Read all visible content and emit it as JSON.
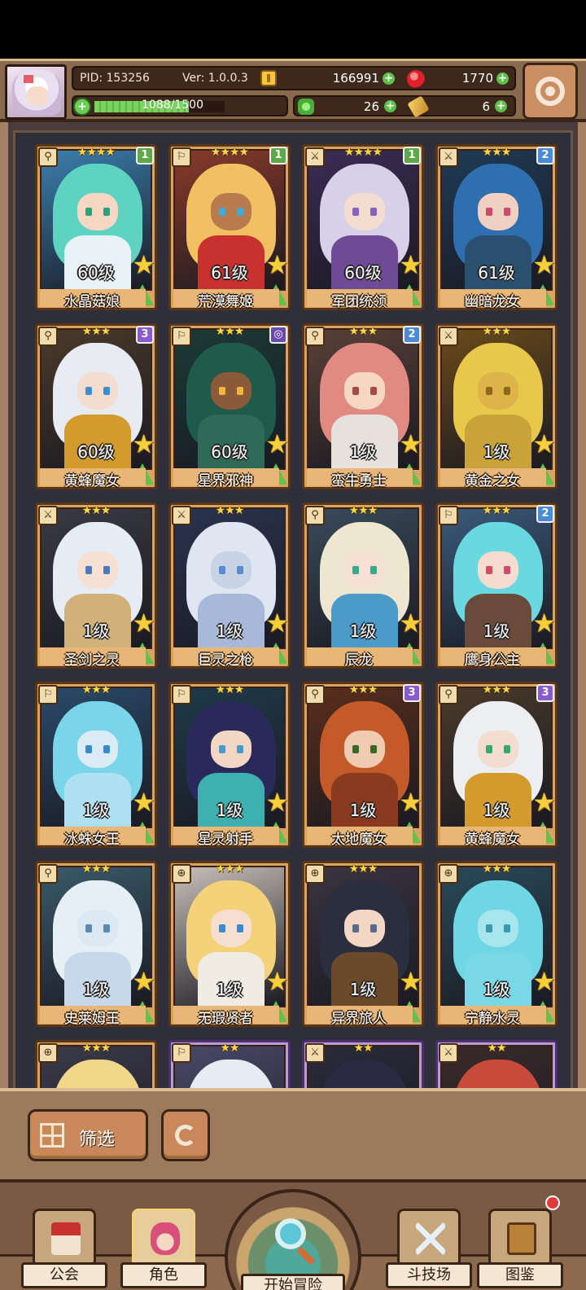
{
  "header": {
    "pid": "PID: 153256",
    "version": "Ver: 1.0.0.3",
    "gold": "166991",
    "gems": "1770",
    "exp": {
      "text": "1088/1500",
      "current": 1088,
      "max": 1500
    },
    "clover": "26",
    "scroll": "6",
    "plus_symbol": "+",
    "exp_symbol": "+",
    "icons": {
      "avatar": "player-avatar",
      "gold": "gold-coin-icon",
      "gem": "red-gem-icon",
      "clover": "clover-icon",
      "scroll": "scroll-icon",
      "settings": "gear-icon"
    }
  },
  "roster": [
    {
      "name": "水晶菇娘",
      "level": "60级",
      "rank": "1",
      "stars": "★★★★",
      "type": "⚲",
      "hair": "#5fd3c2",
      "skin": "#f6d7c4",
      "bg": "#3b7fae",
      "body": "#e9f2f7",
      "eye": "#2aa27a",
      "frame": "gold"
    },
    {
      "name": "荒漠舞姬",
      "level": "61级",
      "rank": "1",
      "stars": "★★★★",
      "type": "⚐",
      "hair": "#f2c062",
      "skin": "#b97a4e",
      "bg": "#8a3a2a",
      "body": "#c8322e",
      "eye": "#3fa9d8",
      "frame": "gold"
    },
    {
      "name": "军团统领",
      "level": "60级",
      "rank": "1",
      "stars": "★★★★",
      "type": "⚔",
      "hair": "#d8d0e8",
      "skin": "#f3dcd0",
      "bg": "#3b2c55",
      "body": "#6f4b96",
      "eye": "#8a5fc4",
      "frame": "gold"
    },
    {
      "name": "幽暗龙女",
      "level": "61级",
      "rank": "2",
      "stars": "★★★",
      "type": "⚔",
      "hair": "#2f6fb0",
      "skin": "#f0d0c2",
      "bg": "#1f3b55",
      "body": "#2b4f6e",
      "eye": "#c94a6a",
      "frame": "gold"
    },
    {
      "name": "黄蜂魔女",
      "level": "60级",
      "rank": "3",
      "stars": "★★★",
      "type": "⚲",
      "hair": "#e8ecf2",
      "skin": "#f3dcd0",
      "bg": "#4a3a2a",
      "body": "#d39a2e",
      "eye": "#3c8fd0",
      "frame": "gold"
    },
    {
      "name": "星界邪神",
      "level": "60级",
      "rank": "◎",
      "stars": "★★★",
      "type": "⚐",
      "hair": "#1f5a4a",
      "skin": "#8a5a3a",
      "bg": "#1c3a36",
      "body": "#2f6a58",
      "eye": "#f0b43a",
      "frame": "gold"
    },
    {
      "name": "蛮牛勇士",
      "level": "1级",
      "rank": "2",
      "stars": "★★★",
      "type": "⚲",
      "hair": "#e08a82",
      "skin": "#f6d7c4",
      "bg": "#5a4038",
      "body": "#e7e1dd",
      "eye": "#a44a4a",
      "frame": "gold"
    },
    {
      "name": "黄金之女",
      "level": "1级",
      "rank": "",
      "stars": "★★★",
      "type": "⚔",
      "hair": "#e8c84a",
      "skin": "#dcb44a",
      "bg": "#6a4a1a",
      "body": "#c9a23a",
      "eye": "#8a6a1a",
      "frame": "gold"
    },
    {
      "name": "圣剑之灵",
      "level": "1级",
      "rank": "",
      "stars": "★★★",
      "type": "⚔",
      "hair": "#e6ecf4",
      "skin": "#f6e0d4",
      "bg": "#3a3a44",
      "body": "#d2b07a",
      "eye": "#4a7ac0",
      "frame": "gold"
    },
    {
      "name": "巨灵之枪",
      "level": "1级",
      "rank": "",
      "stars": "★★★",
      "type": "⚔",
      "hair": "#dfe6f2",
      "skin": "#c8d4e6",
      "bg": "#2a3450",
      "body": "#a8b8d8",
      "eye": "#5a8ad0",
      "frame": "gold"
    },
    {
      "name": "辰龙",
      "level": "1级",
      "rank": "",
      "stars": "★★★",
      "type": "⚲",
      "hair": "#efe6d2",
      "skin": "#f6e0d4",
      "bg": "#3a4a5a",
      "body": "#4c9ac8",
      "eye": "#3aa88a",
      "frame": "gold"
    },
    {
      "name": "鹰身公主",
      "level": "1级",
      "rank": "2",
      "stars": "★★★",
      "type": "⚐",
      "hair": "#6ad8e0",
      "skin": "#f6dcd0",
      "bg": "#3a5a7a",
      "body": "#6a4a3a",
      "eye": "#d04a6a",
      "frame": "gold"
    },
    {
      "name": "冰蛛女王",
      "level": "1级",
      "rank": "",
      "stars": "★★★",
      "type": "⚐",
      "hair": "#7ad4ea",
      "skin": "#dcecf6",
      "bg": "#2a4a6a",
      "body": "#aee0f2",
      "eye": "#3a8ad0",
      "frame": "gold"
    },
    {
      "name": "星灵射手",
      "level": "1级",
      "rank": "",
      "stars": "★★★",
      "type": "⚐",
      "hair": "#2a2a5a",
      "skin": "#f3d6c4",
      "bg": "#1f3a4a",
      "body": "#3fb0b0",
      "eye": "#4a9ad0",
      "frame": "gold"
    },
    {
      "name": "太地魔女",
      "level": "1级",
      "rank": "3",
      "stars": "★★★",
      "type": "⚲",
      "hair": "#c45a2a",
      "skin": "#f0cbb2",
      "bg": "#5a2e1c",
      "body": "#8a3a1e",
      "eye": "#3a6a2a",
      "frame": "gold"
    },
    {
      "name": "黄蜂魔女",
      "level": "1级",
      "rank": "3",
      "stars": "★★★",
      "type": "⚲",
      "hair": "#eceef2",
      "skin": "#f3dcd0",
      "bg": "#4a3a2a",
      "body": "#d39a2e",
      "eye": "#3aa86a",
      "frame": "gold"
    },
    {
      "name": "史莱姆王",
      "level": "1级",
      "rank": "",
      "stars": "★★★",
      "type": "⚲",
      "hair": "#e6eef6",
      "skin": "#dce8f2",
      "bg": "#3a5a6a",
      "body": "#c6d8ea",
      "eye": "#5a8ab0",
      "frame": "gold"
    },
    {
      "name": "无瑕贤者",
      "level": "1级",
      "rank": "",
      "stars": "★★★",
      "type": "⊕",
      "hair": "#f4d27a",
      "skin": "#f6dfd0",
      "bg": "#c8bfb8",
      "body": "#f0ece4",
      "eye": "#3a8ad0",
      "frame": "gold"
    },
    {
      "name": "异界旅人",
      "level": "1级",
      "rank": "",
      "stars": "★★★",
      "type": "⊕",
      "hair": "#2a2e3e",
      "skin": "#f3d6c4",
      "bg": "#3a3440",
      "body": "#6a4a2a",
      "eye": "#5a6a8a",
      "frame": "gold"
    },
    {
      "name": "宁静水灵",
      "level": "1级",
      "rank": "",
      "stars": "★★★",
      "type": "⊕",
      "hair": "#6fd6e4",
      "skin": "#a8e6ee",
      "bg": "#2a4a5a",
      "body": "#7ad8e6",
      "eye": "#3a9ab0",
      "frame": "gold"
    },
    {
      "name": "",
      "level": "",
      "rank": "",
      "stars": "★★★",
      "type": "⊕",
      "hair": "#f2d78a",
      "skin": "#f6dfd0",
      "bg": "#3a3a4a",
      "body": "#e6d2a0",
      "eye": "#3a8ad0",
      "frame": "gold"
    },
    {
      "name": "",
      "level": "",
      "rank": "",
      "stars": "★★",
      "type": "⚐",
      "hair": "#e6ecf4",
      "skin": "#f3dcd0",
      "bg": "#4a4a6a",
      "body": "#d8d8e8",
      "eye": "#4a7ac0",
      "frame": "purple"
    },
    {
      "name": "",
      "level": "",
      "rank": "",
      "stars": "★★",
      "type": "⚔",
      "hair": "#2a2a44",
      "skin": "#f0d0c2",
      "bg": "#2a2a3a",
      "body": "#3a3a5a",
      "eye": "#8a5ad0",
      "frame": "purple"
    },
    {
      "name": "",
      "level": "",
      "rank": "",
      "stars": "★★",
      "type": "⚔",
      "hair": "#c84a3a",
      "skin": "#f0cbb2",
      "bg": "#3a2a2a",
      "body": "#5a2a2a",
      "eye": "#3a6a2a",
      "frame": "purple"
    }
  ],
  "rank_colors": {
    "1": "#5fa84a",
    "2": "#4a8ad8",
    "3": "#8a5ad0",
    "◎": "#6a4ab0"
  },
  "filter": {
    "label": "筛选",
    "icon": "grid-icon",
    "refresh_icon": "refresh-icon"
  },
  "nav": {
    "guild": "公会",
    "roles": "角色",
    "adventure": "开始冒险",
    "arena": "斗技场",
    "codex": "图鉴",
    "active": "roles"
  }
}
